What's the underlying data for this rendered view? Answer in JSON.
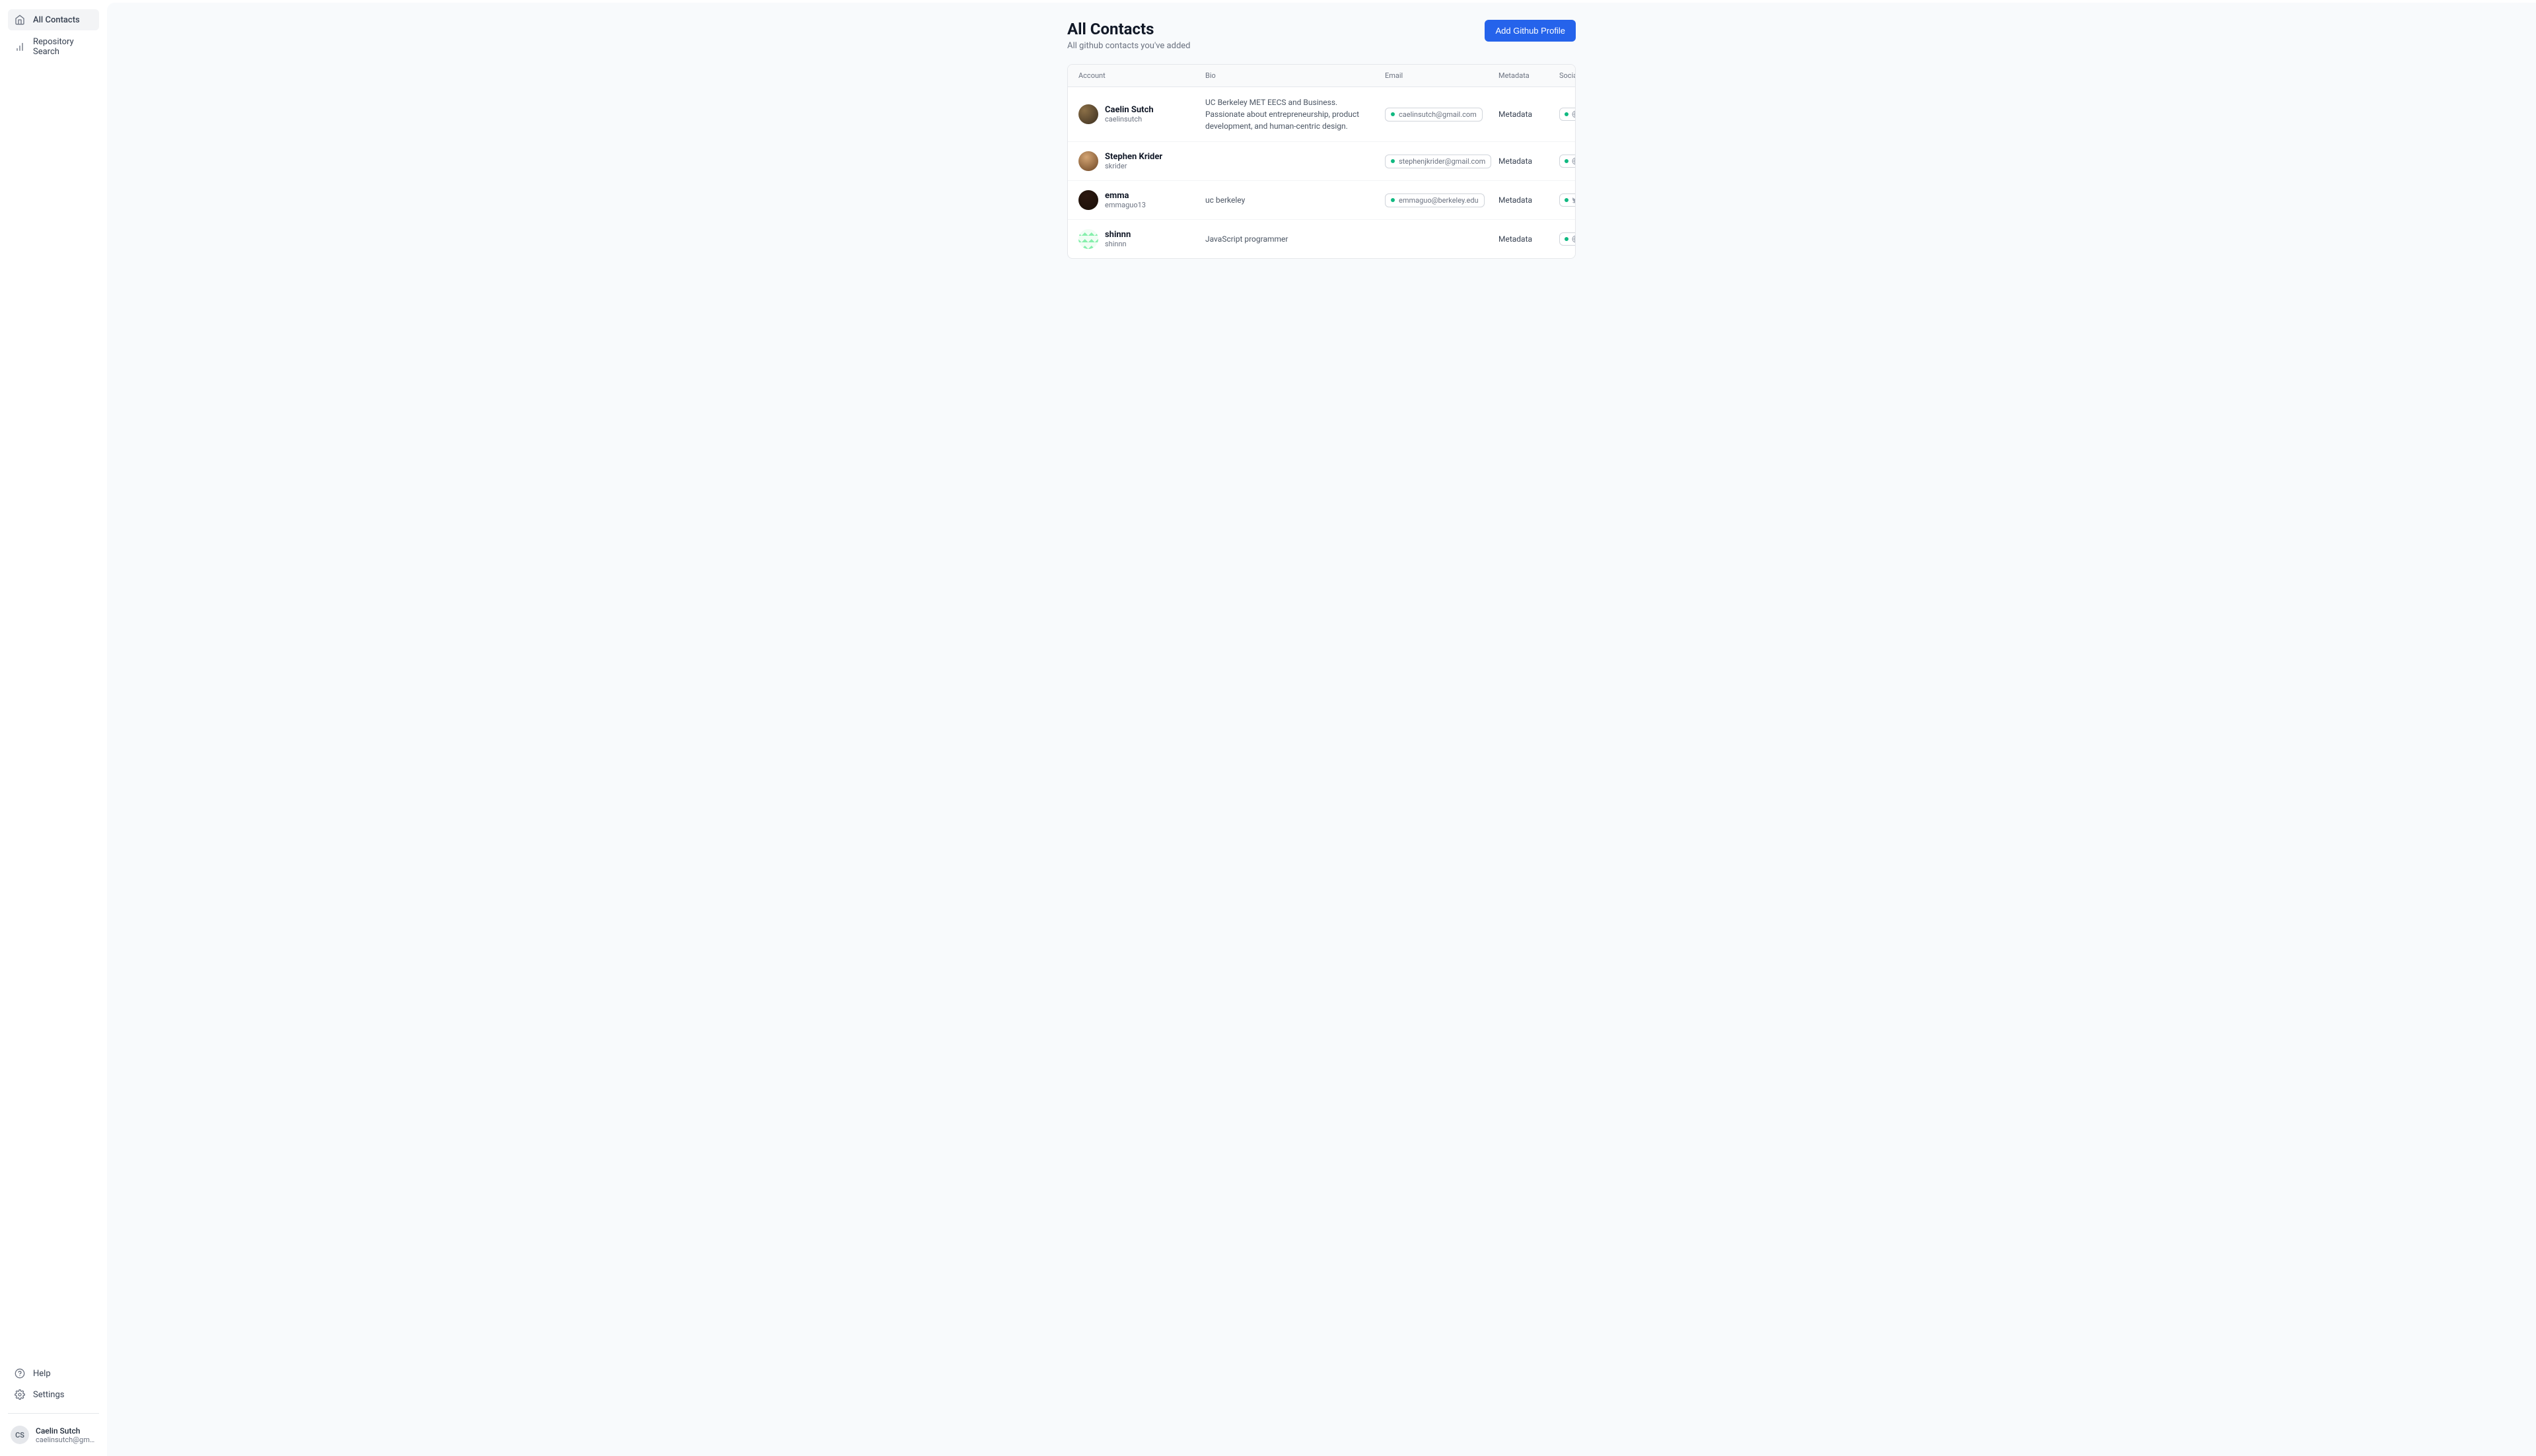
{
  "sidebar": {
    "nav": [
      {
        "label": "All Contacts",
        "icon": "home"
      },
      {
        "label": "Repository Search",
        "icon": "bar-chart"
      }
    ],
    "footer": [
      {
        "label": "Help",
        "icon": "help"
      },
      {
        "label": "Settings",
        "icon": "gear"
      }
    ]
  },
  "user": {
    "initials": "CS",
    "name": "Caelin Sutch",
    "email": "caelinsutch@gmail.com"
  },
  "header": {
    "title": "All Contacts",
    "subtitle": "All github contacts you've added",
    "add_button": "Add Github Profile"
  },
  "table": {
    "columns": {
      "account": "Account",
      "bio": "Bio",
      "email": "Email",
      "metadata": "Metadata",
      "socials": "Socials"
    },
    "metadata_label": "Metadata",
    "rows": [
      {
        "name": "Caelin Sutch",
        "username": "caelinsutch",
        "bio": "UC Berkeley MET EECS and Business. Passionate about entrepreneurship, product development, and human-centric design.",
        "email": "caelinsutch@gmail.com",
        "socials": [
          {
            "dot": "green",
            "icon": "globe"
          },
          {
            "dot": "orange",
            "icon": "twitter"
          },
          {
            "dot": "orange",
            "icon": "linkedin"
          }
        ]
      },
      {
        "name": "Stephen Krider",
        "username": "skrider",
        "bio": "",
        "email": "stephenjkrider@gmail.com",
        "socials": [
          {
            "dot": "green",
            "icon": "globe"
          }
        ]
      },
      {
        "name": "emma",
        "username": "emmaguo13",
        "bio": "uc berkeley",
        "email": "emmaguo@berkeley.edu",
        "socials": [
          {
            "dot": "green",
            "icon": "twitter"
          }
        ]
      },
      {
        "name": "shinnn",
        "username": "shinnn",
        "bio": "JavaScript programmer",
        "email": "",
        "socials": [
          {
            "dot": "green",
            "icon": "globe"
          }
        ]
      }
    ]
  }
}
